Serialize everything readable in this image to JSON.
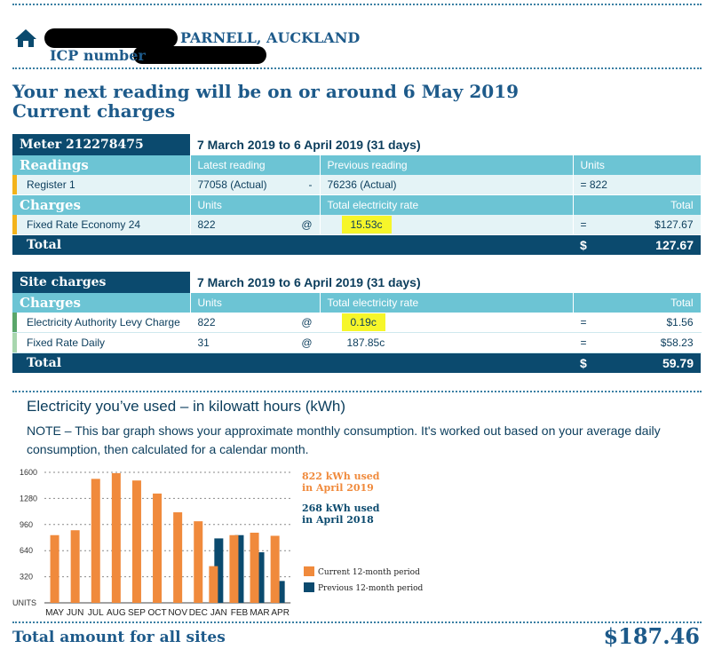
{
  "address": {
    "icon": "home-icon",
    "suburb_city": "PARNELL, AUCKLAND",
    "icp_label": "ICP number"
  },
  "next_reading": "Your next reading will be on or around 6 May 2019",
  "current_charges_title": "Current charges",
  "meter_table": {
    "meter_label": "Meter  212278475",
    "period": "7 March 2019 to 6 April 2019 (31 days)",
    "readings_head": {
      "label": "Readings",
      "latest": "Latest reading",
      "previous": "Previous reading",
      "units": "Units"
    },
    "reading_row": {
      "register": "Register 1",
      "latest": "77058 (Actual)",
      "dash": "-",
      "previous": "76236 (Actual)",
      "eq": "=",
      "units": "822"
    },
    "charges_head": {
      "label": "Charges",
      "units": "Units",
      "rate": "Total electricity rate",
      "total": "Total"
    },
    "charge_row": {
      "name": "Fixed Rate Economy 24",
      "units": "822",
      "at": "@",
      "rate": "15.53c",
      "eq": "=",
      "total": "$127.67"
    },
    "total_row": {
      "label": "Total",
      "currency": "$",
      "amount": "127.67"
    }
  },
  "site_table": {
    "title": "Site charges",
    "period": "7 March 2019 to 6 April 2019 (31 days)",
    "charges_head": {
      "label": "Charges",
      "units": "Units",
      "rate": "Total electricity rate",
      "total": "Total"
    },
    "rows": [
      {
        "name": "Electricity Authority Levy Charge",
        "units": "822",
        "at": "@",
        "rate": "0.19c",
        "eq": "=",
        "total": "$1.56"
      },
      {
        "name": "Fixed Rate Daily",
        "units": "31",
        "at": "@",
        "rate": "187.85c",
        "eq": "=",
        "total": "$58.23"
      }
    ],
    "total_row": {
      "label": "Total",
      "currency": "$",
      "amount": "59.79"
    }
  },
  "usage_title": "Electricity you’ve used – in kilowatt hours (kWh)",
  "usage_note": "NOTE – This bar graph shows your approximate monthly consumption.  It's worked out based on your average daily consumption, then calculated for a calendar month.",
  "chart_data": {
    "type": "bar",
    "categories": [
      "MAY",
      "JUN",
      "JUL",
      "AUG",
      "SEP",
      "OCT",
      "NOV",
      "DEC",
      "JAN",
      "FEB",
      "MAR",
      "APR"
    ],
    "ylim": [
      0,
      1600
    ],
    "yticks": [
      "1600",
      "1280",
      "960",
      "640",
      "320"
    ],
    "ylabel": "UNITS",
    "grid": true,
    "series": [
      {
        "name": "Current 12-month period",
        "color": "#f08a3c",
        "values": [
          830,
          890,
          1520,
          1590,
          1500,
          1340,
          1110,
          1000,
          450,
          830,
          860,
          822
        ]
      },
      {
        "name": "Previous 12-month period",
        "color": "#0b4a6e",
        "values": [
          0,
          0,
          0,
          0,
          0,
          0,
          0,
          0,
          790,
          830,
          620,
          268
        ]
      }
    ],
    "annotations": [
      {
        "text_line1": "822 kWh used",
        "text_line2": "in April 2019",
        "color": "#f08a3c"
      },
      {
        "text_line1": "268 kWh used",
        "text_line2": "in April 2018",
        "color": "#0b4a6e"
      }
    ]
  },
  "grand_total": {
    "label": "Total amount for all sites",
    "amount": "$187.46"
  }
}
